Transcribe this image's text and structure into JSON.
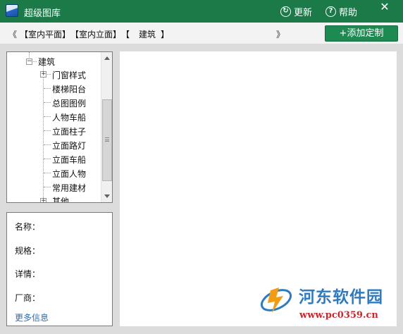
{
  "window": {
    "title": "超级图库",
    "refresh_label": "更新",
    "help_label": "帮助",
    "close_glyph": "✕"
  },
  "breadcrumb": {
    "prev": "《",
    "next": "》",
    "items": [
      "【室内平面】",
      "【室内立面】",
      "【",
      "建筑",
      "】"
    ]
  },
  "toolbar": {
    "add_label": "+添加定制"
  },
  "tree": {
    "root": "建筑",
    "items": [
      {
        "label": "门窗样式",
        "expandable": true
      },
      {
        "label": "楼梯阳台",
        "expandable": false
      },
      {
        "label": "总图图例",
        "expandable": false
      },
      {
        "label": "人物车船",
        "expandable": false
      },
      {
        "label": "立面柱子",
        "expandable": false
      },
      {
        "label": "立面路灯",
        "expandable": false
      },
      {
        "label": "立面车船",
        "expandable": false
      },
      {
        "label": "立面人物",
        "expandable": false
      },
      {
        "label": "常用建材",
        "expandable": false
      },
      {
        "label": "其他",
        "expandable": true
      }
    ]
  },
  "info": {
    "name_label": "名称：",
    "spec_label": "规格：",
    "detail_label": "详情：",
    "vendor_label": "厂商：",
    "more_label": "更多信息"
  },
  "watermark": {
    "title": "河东软件园",
    "url": "www.pc0359.cn"
  },
  "colors": {
    "title_bar": "#1b7a48",
    "accent_button": "#1e8a52",
    "link": "#2e6db4"
  }
}
